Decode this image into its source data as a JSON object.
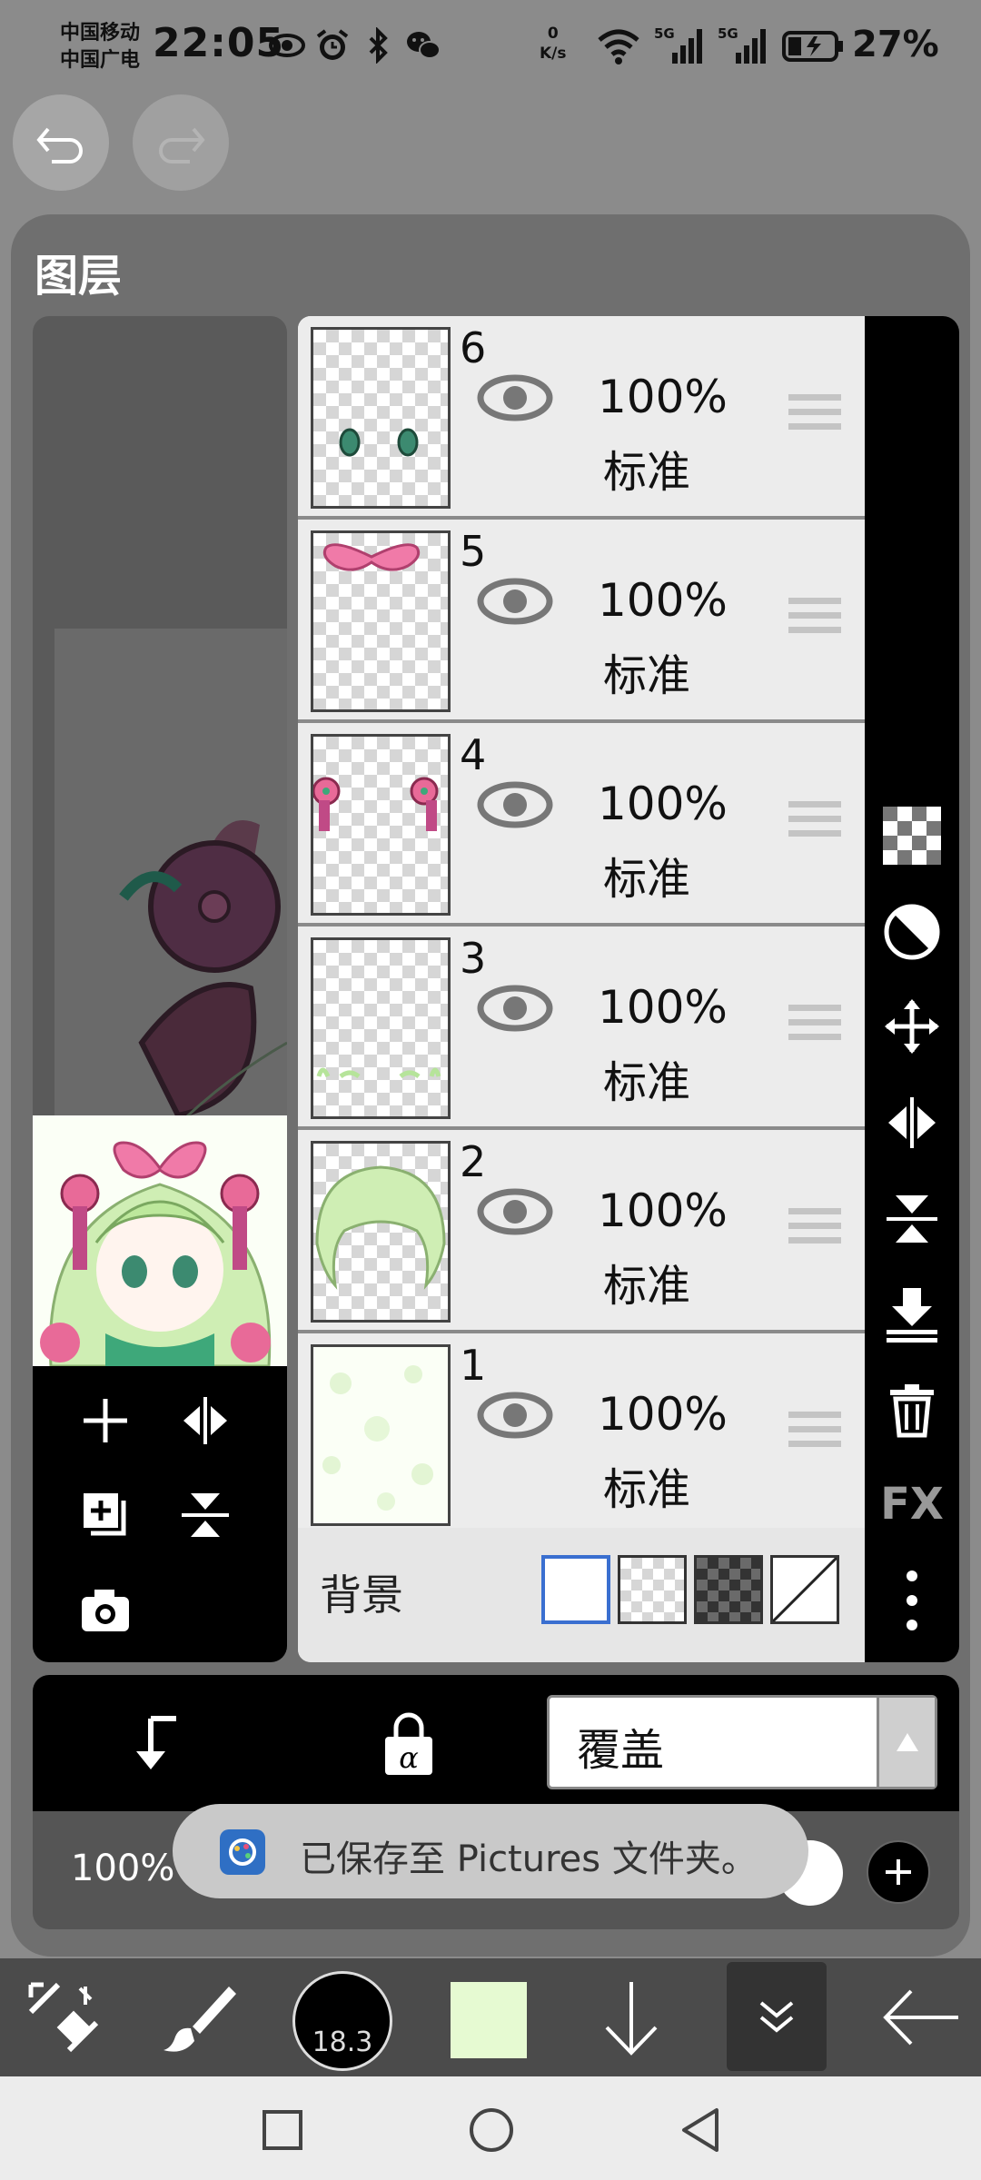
{
  "status_bar": {
    "carrier_line1": "中国移动",
    "carrier_line2": "中国广电",
    "time": "22:05",
    "net_speed_value": "0",
    "net_speed_unit": "K/s",
    "signal1_label": "5G",
    "signal2_label": "5G",
    "battery": "27%"
  },
  "panel": {
    "title": "图层"
  },
  "layers": [
    {
      "number": "6",
      "opacity": "100%",
      "mode": "标准"
    },
    {
      "number": "5",
      "opacity": "100%",
      "mode": "标准"
    },
    {
      "number": "4",
      "opacity": "100%",
      "mode": "标准"
    },
    {
      "number": "3",
      "opacity": "100%",
      "mode": "标准"
    },
    {
      "number": "2",
      "opacity": "100%",
      "mode": "标准"
    },
    {
      "number": "1",
      "opacity": "100%",
      "mode": "标准"
    }
  ],
  "background": {
    "label": "背景"
  },
  "right_tools": {
    "fx_label": "FX"
  },
  "blend": {
    "value": "覆盖"
  },
  "opacity_bar": {
    "label": "100%"
  },
  "toast": {
    "text": "已保存至 Pictures 文件夹。"
  },
  "toolbar": {
    "brush_size": "18.3",
    "color": "#e6fad2"
  }
}
